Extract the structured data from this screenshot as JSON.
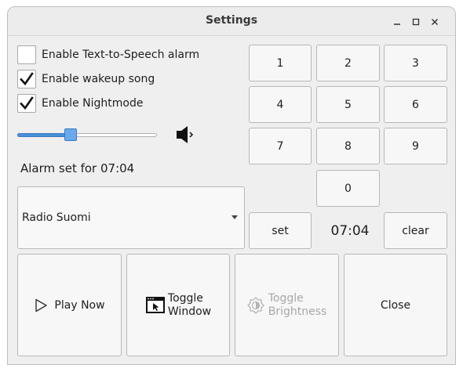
{
  "window": {
    "title": "Settings",
    "controls": [
      "minimize-icon",
      "maximize-icon",
      "close-icon"
    ]
  },
  "checkboxes": [
    {
      "label": "Enable Text-to-Speech alarm",
      "checked": false
    },
    {
      "label": "Enable wakeup song",
      "checked": true
    },
    {
      "label": "Enable Nightmode",
      "checked": true
    }
  ],
  "volume": {
    "level": 0.37,
    "icon": "speaker-icon"
  },
  "alarm_status": "Alarm set for 07:04",
  "station_select": {
    "value": "Radio Suomi"
  },
  "keypad": {
    "keys": [
      "1",
      "2",
      "3",
      "4",
      "5",
      "6",
      "7",
      "8",
      "9",
      "0"
    ],
    "set_label": "set",
    "clear_label": "clear",
    "time": "07:04"
  },
  "actions": {
    "play_now": "Play Now",
    "toggle_window_1": "Toggle",
    "toggle_window_2": "Window",
    "toggle_brightness_1": "Toggle",
    "toggle_brightness_2": "Brightness",
    "close": "Close"
  },
  "colors": {
    "accent": "#4a90d9",
    "window_bg": "#efefef",
    "disabled_text": "#a8a8a8"
  }
}
